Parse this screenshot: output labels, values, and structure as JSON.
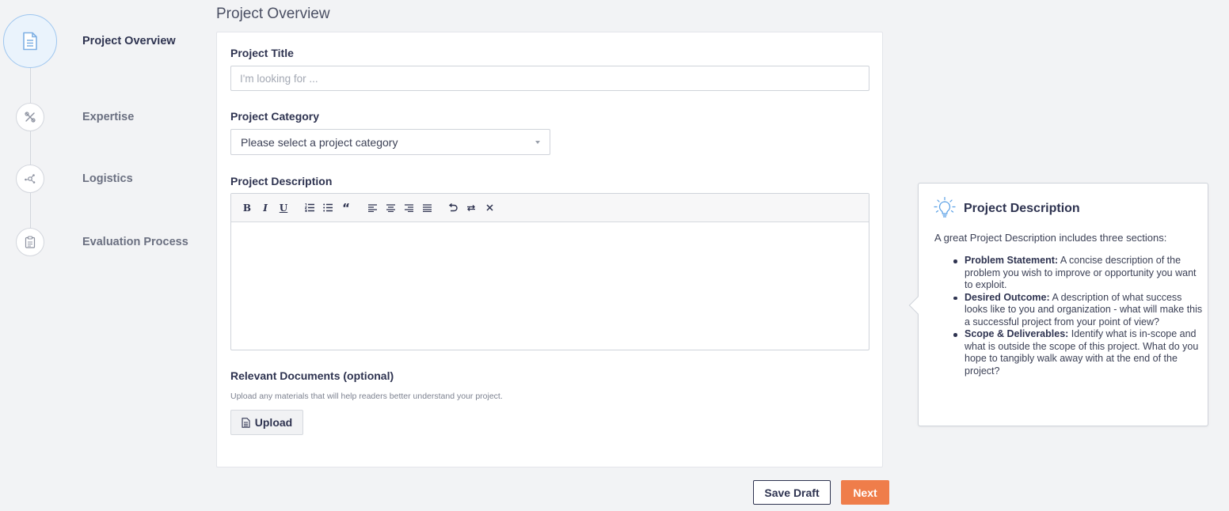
{
  "stepper": {
    "steps": [
      {
        "label": "Project Overview",
        "icon": "document-icon",
        "active": true
      },
      {
        "label": "Expertise",
        "icon": "tools-icon",
        "active": false
      },
      {
        "label": "Logistics",
        "icon": "network-icon",
        "active": false
      },
      {
        "label": "Evaluation Process",
        "icon": "clipboard-icon",
        "active": false
      }
    ]
  },
  "page": {
    "title": "Project Overview"
  },
  "form": {
    "title_label": "Project Title",
    "title_placeholder": "I'm looking for ...",
    "title_value": "",
    "category_label": "Project Category",
    "category_selected": "Please select a project category",
    "description_label": "Project Description",
    "description_value": "",
    "toolbar": [
      "bold",
      "italic",
      "underline",
      "ordered-list",
      "bullet-list",
      "blockquote",
      "align-left",
      "align-center",
      "align-right",
      "align-justify",
      "undo",
      "redo",
      "clear-format"
    ],
    "docs_label": "Relevant Documents (optional)",
    "docs_help": "Upload any materials that will help readers better understand your project.",
    "upload_label": "Upload"
  },
  "actions": {
    "save_label": "Save Draft",
    "next_label": "Next"
  },
  "tip": {
    "title": "Project Description",
    "intro": "A great Project Description includes three sections:",
    "items": [
      {
        "term": "Problem Statement:",
        "text": " A concise description of the problem you wish to improve or opportunity you want to exploit."
      },
      {
        "term": "Desired Outcome:",
        "text": " A description of what success looks like to you and organization - what will make this a successful project from your point of view?"
      },
      {
        "term": "Scope & Deliverables:",
        "text": " Identify what is in-scope and what is outside the scope of this project. What do you hope to tangibly walk away with at the end of the project?"
      }
    ]
  },
  "colors": {
    "accent": "#ef7d4a",
    "text": "#2e3350",
    "active_step": "#eaf3fc",
    "active_step_border": "#9ec6ef"
  }
}
